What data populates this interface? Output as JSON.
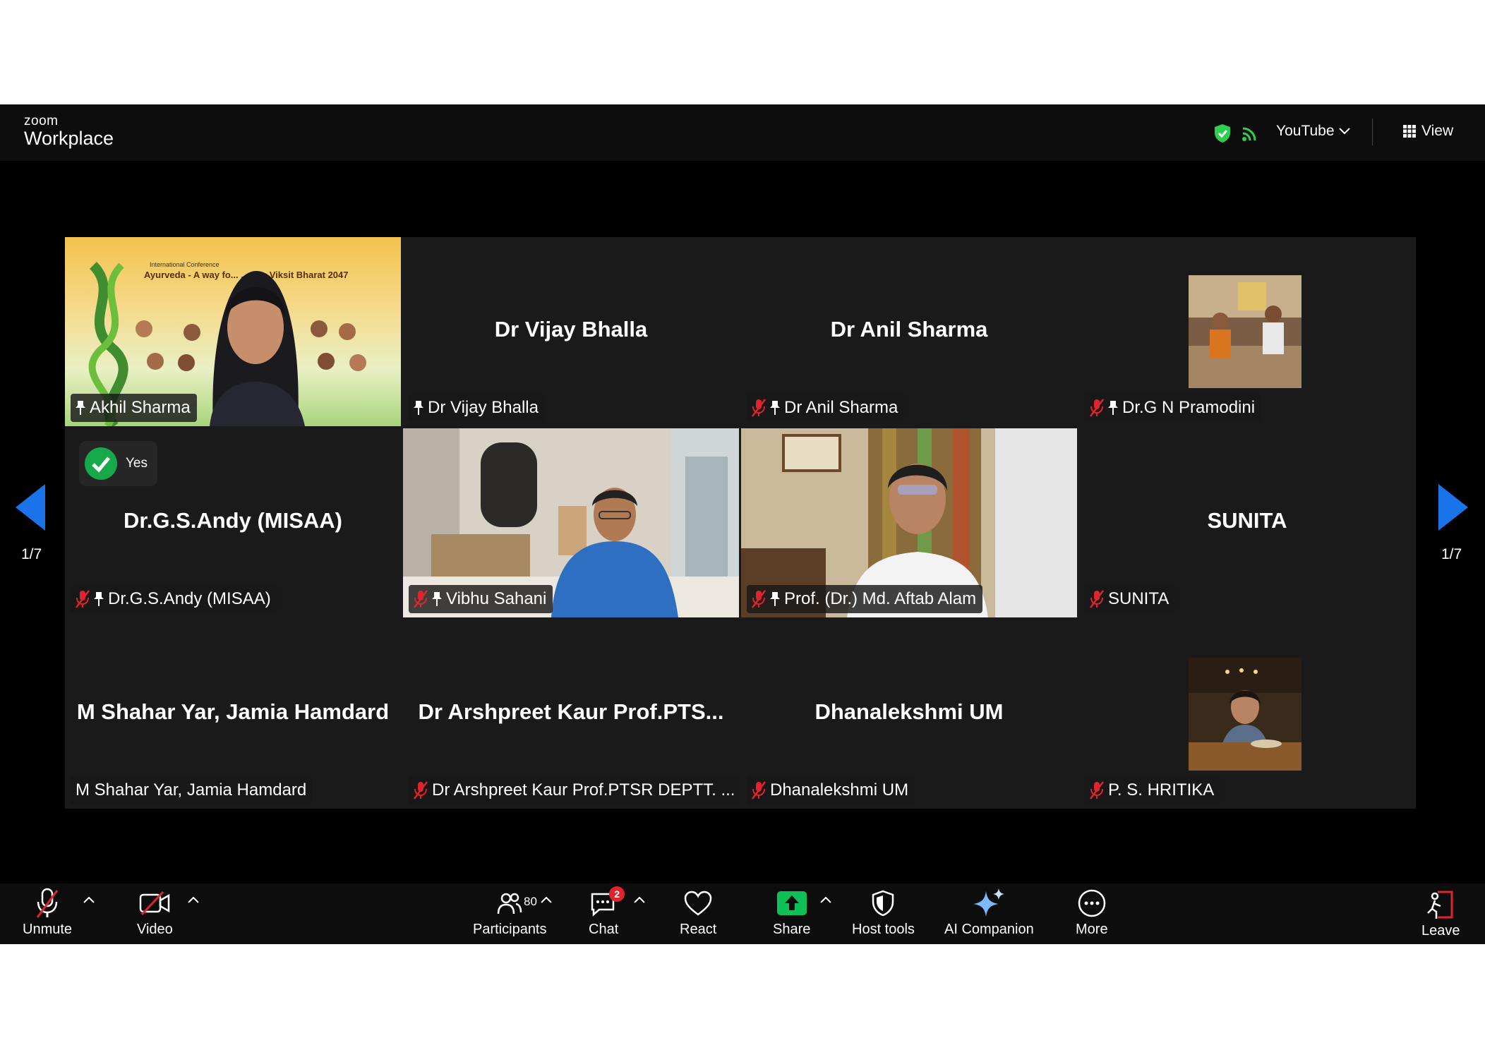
{
  "brand": {
    "top": "zoom",
    "bottom": "Workplace"
  },
  "topbar": {
    "stream": "YouTube",
    "view": "View"
  },
  "pagination": {
    "left": "1/7",
    "right": "1/7"
  },
  "tiles": [
    {
      "center": "",
      "label": "Akhil Sharma",
      "muted": false,
      "pinned": true
    },
    {
      "center": "Dr Vijay Bhalla",
      "label": "Dr Vijay Bhalla",
      "muted": false,
      "pinned": true
    },
    {
      "center": "Dr Anil Sharma",
      "label": "Dr Anil Sharma",
      "muted": true,
      "pinned": true
    },
    {
      "center": "",
      "label": "Dr.G N Pramodini",
      "muted": true,
      "pinned": true
    },
    {
      "center": "Dr.G.S.Andy (MISAA)",
      "label": "Dr.G.S.Andy (MISAA)",
      "muted": true,
      "pinned": true,
      "reaction": "Yes"
    },
    {
      "center": "",
      "label": "Vibhu Sahani",
      "muted": true,
      "pinned": true
    },
    {
      "center": "",
      "label": "Prof. (Dr.) Md. Aftab Alam",
      "muted": true,
      "pinned": true
    },
    {
      "center": "SUNITA",
      "label": "SUNITA",
      "muted": true,
      "pinned": false
    },
    {
      "center": "M Shahar Yar, Jamia Hamdard",
      "label": "M Shahar Yar, Jamia Hamdard",
      "muted": false,
      "pinned": false
    },
    {
      "center": "Dr Arshpreet Kaur Prof.PTS...",
      "label": "Dr Arshpreet Kaur Prof.PTSR DEPTT. ...",
      "muted": true,
      "pinned": false
    },
    {
      "center": "Dhanalekshmi UM",
      "label": "Dhanalekshmi UM",
      "muted": true,
      "pinned": false
    },
    {
      "center": "",
      "label": "P. S. HRITIKA",
      "muted": true,
      "pinned": false
    }
  ],
  "poster": {
    "title": "Ayurveda - A way fo...   ...ess: Viksit Bharat 2047",
    "subtitle": "International Conference"
  },
  "toolbar": {
    "unmute": "Unmute",
    "video": "Video",
    "participants": "Participants",
    "participants_count": "80",
    "chat": "Chat",
    "chat_badge": "2",
    "react": "React",
    "share": "Share",
    "host_tools": "Host tools",
    "ai_companion": "AI Companion",
    "more": "More",
    "leave": "Leave"
  },
  "colors": {
    "active_speaker": "#2dd04c",
    "muted_red": "#e0242d",
    "share_green": "#0fbf58",
    "nav_blue": "#1a73e8"
  }
}
